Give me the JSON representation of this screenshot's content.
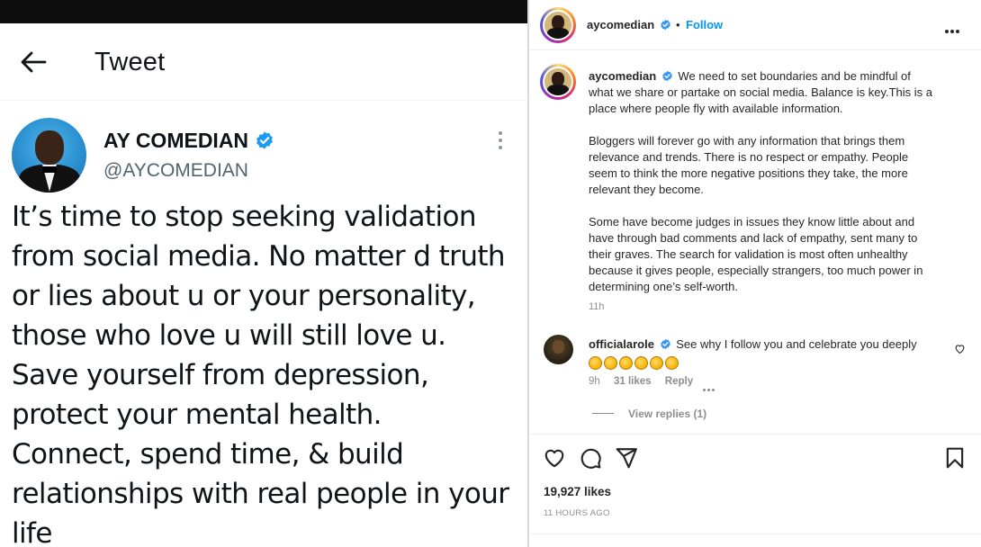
{
  "twitter": {
    "header_title": "Tweet",
    "author_name": "AY COMEDIAN",
    "author_handle": "@AYCOMEDIAN",
    "tweet_lines": [
      "It’s time to stop seeking validation",
      "from social media. No matter d truth",
      "or lies about u or your personality,",
      "those who love u will still love u.",
      "Save yourself from depression,",
      "protect your mental health.",
      "Connect, spend time, & build",
      "relationships with real people in your",
      "life"
    ],
    "colors": {
      "verified": "#1d9bf0",
      "text": "#0f1419",
      "handle": "#536471"
    }
  },
  "instagram": {
    "header": {
      "username": "aycomedian",
      "separator": "•",
      "follow_label": "Follow"
    },
    "caption": {
      "username": "aycomedian",
      "lines": [
        "We need to set boundaries and be mindful of",
        "what we share or partake on social media. Balance is key.This is a",
        "place where people fly with available information.",
        "",
        "Bloggers will forever go with any information that brings them",
        "relevance and trends. There is no respect or empathy. People",
        "seem to think the more negative positions they take, the more",
        "relevant they become.",
        "",
        "Some have become judges in issues they know little about and",
        "have through bad comments and lack of empathy, sent many to",
        "their graves. The search for validation is most often unhealthy",
        "because it gives people, especially strangers, too much power in",
        "determining one’s self-worth."
      ],
      "time": "11h"
    },
    "comment": {
      "username": "officialarole",
      "text": "See why I follow you and celebrate you deeply",
      "clap_count": 6,
      "time": "9h",
      "likes": "31 likes",
      "reply_label": "Reply",
      "view_replies": "View replies (1)"
    },
    "likes": "19,927 likes",
    "posted_ago": "11 HOURS AGO",
    "icons": [
      "heart-icon",
      "comment-icon",
      "share-icon",
      "bookmark-icon"
    ],
    "colors": {
      "follow": "#0095f6",
      "verified": "#3897f0",
      "muted": "#8e8e8e"
    }
  }
}
